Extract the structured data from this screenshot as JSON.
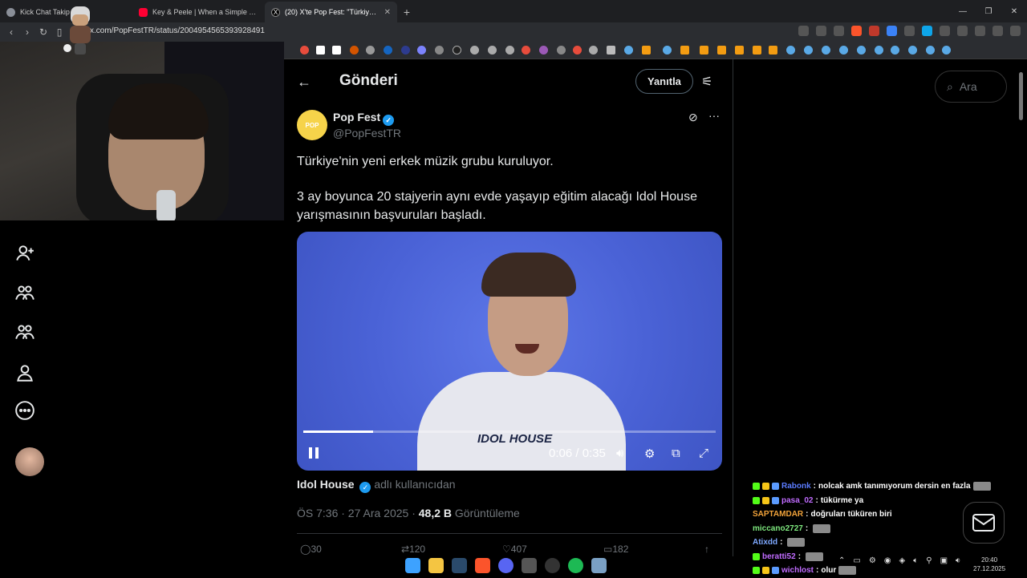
{
  "browser": {
    "tabs": [
      {
        "title": "Kick Chat Takip | W...",
        "icon_color": "#8a8f98",
        "active": false
      },
      {
        "title": "Key & Peele | When a Simple Talk",
        "icon_color": "#ff0033",
        "active": false
      },
      {
        "title": "(20) X'te Pop Fest: \"Türkiye'nin y...",
        "icon_color": "#ffffff",
        "active": true
      }
    ],
    "url": "x.com/PopFestTR/status/2004954565393928491",
    "new_tab_label": "+"
  },
  "post_page": {
    "header_title": "Gönderi",
    "reply_button": "Yanıtla",
    "author": {
      "name": "Pop Fest",
      "handle": "@PopFestTR",
      "avatar_text": "POP",
      "verified_color": "#1d9bf0"
    },
    "tweet_lines": [
      "Türkiye'nin yeni erkek müzik grubu kuruluyor.",
      "3 ay boyunca 20 stajyerin aynı evde yaşayıp eğitim alacağı Idol House yarışmasının başvuruları başladı."
    ],
    "video": {
      "time": "0:06 / 0:35",
      "progress": 0.17,
      "overlay_logo": "IDOL HOUSE"
    },
    "source": {
      "name": "Idol House",
      "suffix": "adlı kullanıcıdan"
    },
    "meta": {
      "time_date": "ÖS 7:36 · 27 Ara 2025 · ",
      "views_count": "48,2 B",
      "views_label": " Görüntüleme"
    },
    "actions": {
      "replies": "30",
      "reposts": "120",
      "likes": "407",
      "bookmarks": "182"
    }
  },
  "search": {
    "placeholder": "Ara"
  },
  "chat": [
    {
      "user": "Rabonk",
      "user_color": "#5b7cff",
      "message": "nolcak amk tanımıyorum dersin en fazla",
      "emote": true
    },
    {
      "user": "pasa_02",
      "user_color": "#c06bff",
      "message": "tükürme ya",
      "emote": false
    },
    {
      "user": "SAPTAMDAR",
      "user_color": "#f2a33a",
      "message": "doğruları tüküren biri",
      "emote": false
    },
    {
      "user": "miccano2727",
      "user_color": "#7ee87e",
      "message": "",
      "emote": true
    },
    {
      "user": "Atixdd",
      "user_color": "#7ea8ff",
      "message": "",
      "emote": true
    },
    {
      "user": "beratti52",
      "user_color": "#c06bff",
      "message": "",
      "emote": true
    },
    {
      "user": "wichlost",
      "user_color": "#c06bff",
      "message": "olur",
      "emote": true
    }
  ],
  "clock": {
    "time": "20:40",
    "date": "27.12.2025"
  },
  "colors": {
    "accent": "#1d9bf0",
    "background": "#000000",
    "text_secondary": "#71767b"
  }
}
